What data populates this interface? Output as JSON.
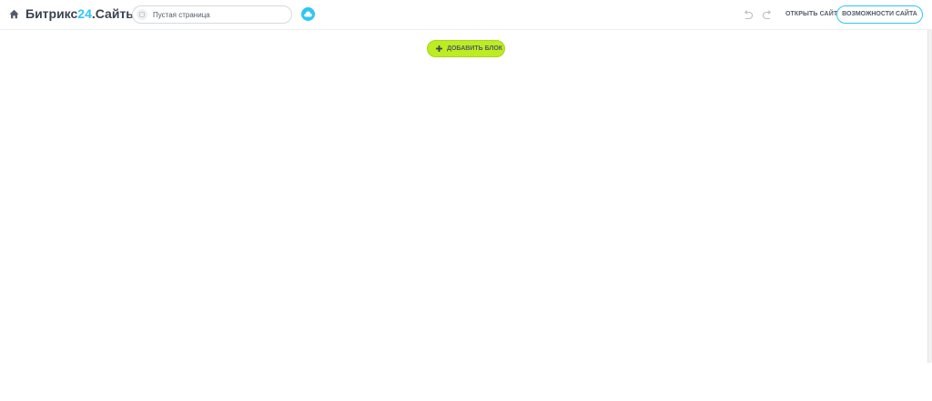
{
  "header": {
    "logo_main": "Битрикс",
    "logo_accent": "24",
    "logo_suffix": ".Сайты",
    "page_title": "Пустая страница",
    "open_site_label": "ОТКРЫТЬ САЙТ",
    "features_label": "ВОЗМОЖНОСТИ САЙТА",
    "icons": {
      "home": "home-icon",
      "page": "page-icon",
      "cloud": "cloud-icon",
      "undo": "undo-icon",
      "redo": "redo-icon"
    }
  },
  "content": {
    "add_block_label": "ДОБАВИТЬ БЛОК",
    "add_icon": "plus-icon"
  },
  "colors": {
    "accent": "#2fc6f6",
    "add_button": "#bbed21",
    "text": "#525c69",
    "logo_text": "#3a4351"
  }
}
